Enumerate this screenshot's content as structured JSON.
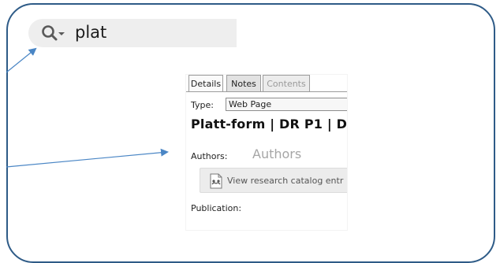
{
  "search": {
    "query": "plat",
    "icon": "search-dropdown-icon"
  },
  "tabs": [
    {
      "label": "Details",
      "state": "active"
    },
    {
      "label": "Notes",
      "state": "normal"
    },
    {
      "label": "Contents",
      "state": "disabled"
    }
  ],
  "item": {
    "type_label": "Type:",
    "type_value": "Web Page",
    "title": "Platt-form | DR P1 | D",
    "authors_label": "Authors:",
    "authors_value": "Authors",
    "catalog_button_label": "View research catalog entr",
    "catalog_icon": "catalog-document-icon",
    "publication_label": "Publication:"
  },
  "colors": {
    "frame": "#2e5b87",
    "callout_arrow": "#4a86c5"
  }
}
